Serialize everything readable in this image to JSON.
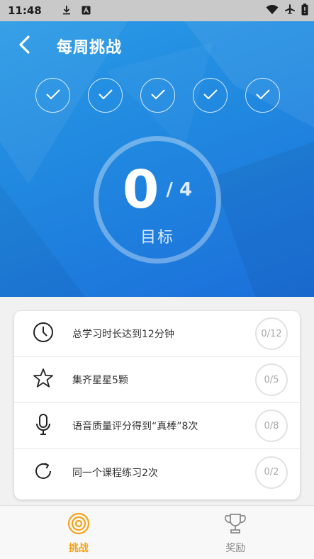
{
  "status_bar": {
    "time": "11:48",
    "icons": [
      "download-icon",
      "a-notification-icon",
      "wifi-icon",
      "airplane-icon",
      "battery-icon"
    ]
  },
  "header": {
    "title": "每周挑战",
    "back_icon": "chevron-left-icon"
  },
  "weekly_checks": {
    "count": 5,
    "icon": "check-icon"
  },
  "goal": {
    "current": "0",
    "total": "/ 4",
    "label": "目标",
    "progress_fraction": 0
  },
  "tasks": [
    {
      "icon": "clock-icon",
      "text": "总学习时长达到12分钟",
      "progress": "0/12"
    },
    {
      "icon": "star-icon",
      "text": "集齐星星5颗",
      "progress": "0/5"
    },
    {
      "icon": "microphone-icon",
      "text": "语音质量评分得到“真棒”8次",
      "progress": "0/8"
    },
    {
      "icon": "refresh-icon",
      "text": "同一个课程练习2次",
      "progress": "0/2"
    }
  ],
  "tabs": [
    {
      "label": "挑战",
      "icon": "target-icon",
      "active": true
    },
    {
      "label": "奖励",
      "icon": "trophy-icon",
      "active": false
    }
  ],
  "colors": {
    "hero_gradient_start": "#2b9ce6",
    "hero_gradient_end": "#1b6fda",
    "active_tab": "#f5a316",
    "inactive_tab": "#8a8a8a"
  }
}
